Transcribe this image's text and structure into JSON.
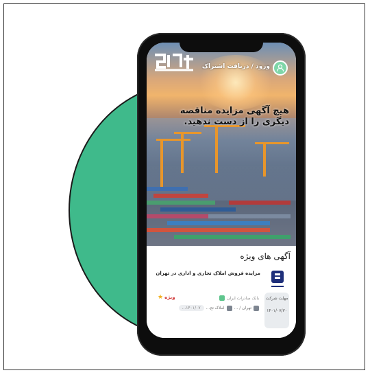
{
  "app": {
    "logo_alt": "حراج مناقصه",
    "login_label": "ورود / دریافت اشتراک",
    "headline": "هیچ آگهی مزایده مناقصه دیگری را از دست ندهید."
  },
  "section": {
    "title": "آگهی های ویژه"
  },
  "card": {
    "title": "مزایده فروش املاک تجاری و اداری در تهران",
    "organization": "بانک صادرات ایران",
    "badge": "ویژه",
    "location": "تهران / ...",
    "category": "املاک تج...",
    "date_chip": "۱۴۰۱/۰۷...",
    "deadline_label": "مهلت شرکت",
    "deadline_date": "۱۴۰۱/۰۷/۳۰"
  },
  "colors": {
    "circle": "#3fba8b",
    "badge_red": "#d23b3b",
    "login_green": "#7fd6a8"
  }
}
